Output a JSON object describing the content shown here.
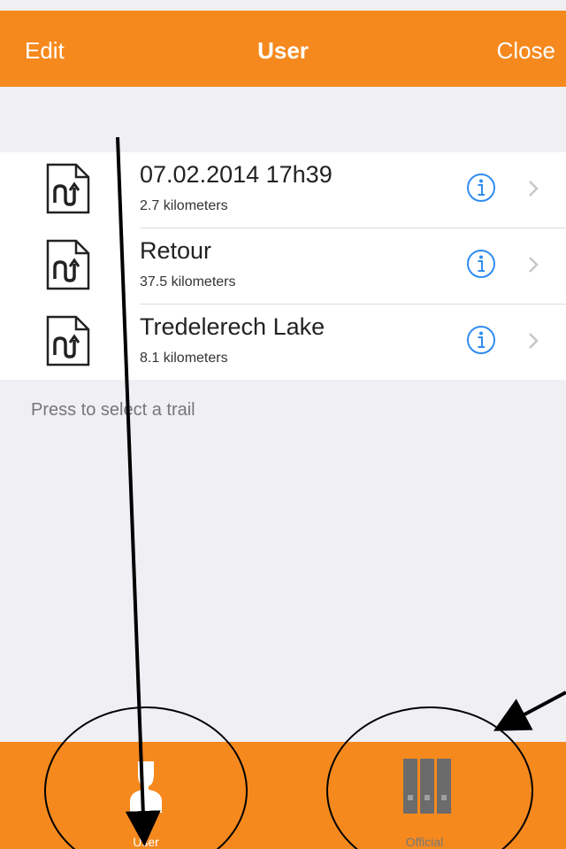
{
  "navbar": {
    "edit_label": "Edit",
    "title": "User",
    "close_label": "Close"
  },
  "trails": [
    {
      "title": "07.02.2014 17h39",
      "distance": "2.7 kilometers"
    },
    {
      "title": "Retour",
      "distance": "37.5 kilometers"
    },
    {
      "title": "Tredelerech Lake",
      "distance": "8.1 kilometers"
    }
  ],
  "hint": "Press to select a trail",
  "tabbar": {
    "tabs": [
      {
        "label": "User",
        "icon": "user-icon",
        "selected": true
      },
      {
        "label": "Official",
        "icon": "books-icon",
        "selected": false
      }
    ]
  },
  "colors": {
    "accent": "#f5891e",
    "background": "#efeff4",
    "info_blue": "#2f8cf0",
    "annotation": "#000000"
  }
}
